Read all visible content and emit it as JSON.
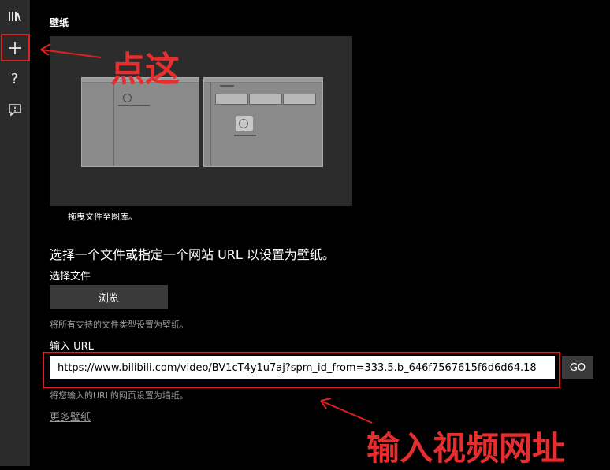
{
  "sidebar": {
    "items": [
      {
        "icon": "library-icon"
      },
      {
        "icon": "plus-icon"
      },
      {
        "icon": "help-icon",
        "glyph": "?"
      },
      {
        "icon": "feedback-icon"
      }
    ]
  },
  "page": {
    "title": "壁纸",
    "drag_caption": "拖曳文件至图库。",
    "heading": "选择一个文件或指定一个网站 URL 以设置为壁纸。",
    "choose_file_label": "选择文件",
    "browse_button": "浏览",
    "file_hint": "将所有支持的文件类型设置为壁纸。",
    "url_label": "输入 URL",
    "url_value": "https://www.bilibili.com/video/BV1cT4y1u7aj?spm_id_from=333.5.b_646f7567615f6d6d64.18",
    "go_button": "GO",
    "url_hint": "将您输入的URL的网页设置为墙纸。",
    "more_wallpapers": "更多壁纸"
  },
  "annotations": {
    "click_here": "点这",
    "enter_video_url": "输入视频网址",
    "color": "#e02020"
  }
}
